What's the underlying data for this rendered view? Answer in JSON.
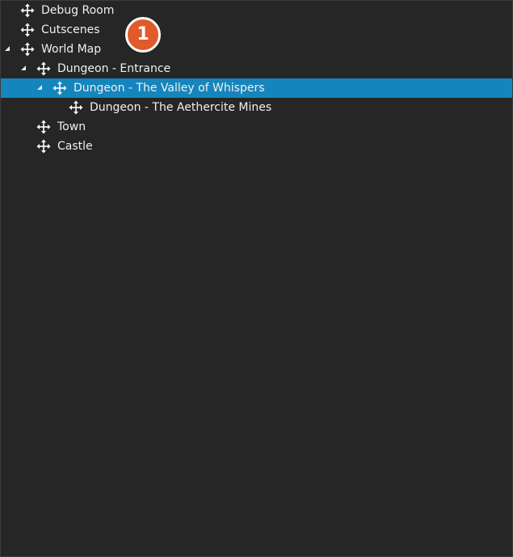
{
  "tree": {
    "items": [
      {
        "label": "Debug Room",
        "icon": "move-icon",
        "expanded": false,
        "has_children": false,
        "selected": false
      },
      {
        "label": "Cutscenes",
        "icon": "move-icon",
        "expanded": false,
        "has_children": false,
        "selected": false
      },
      {
        "label": "World Map",
        "icon": "move-icon",
        "expanded": true,
        "has_children": true,
        "selected": false
      },
      {
        "label": "Dungeon - Entrance",
        "icon": "move-icon",
        "expanded": true,
        "has_children": true,
        "selected": false
      },
      {
        "label": "Dungeon - The Valley of Whispers",
        "icon": "move-icon",
        "expanded": true,
        "has_children": true,
        "selected": true
      },
      {
        "label": "Dungeon - The Aethercite Mines",
        "icon": "move-icon",
        "expanded": false,
        "has_children": false,
        "selected": false
      },
      {
        "label": "Town",
        "icon": "move-icon",
        "expanded": false,
        "has_children": false,
        "selected": false
      },
      {
        "label": "Castle",
        "icon": "move-icon",
        "expanded": false,
        "has_children": false,
        "selected": false
      }
    ]
  },
  "callout": {
    "number": "1"
  },
  "colors": {
    "background": "#262626",
    "selection": "#1585bd",
    "text": "#f0f0f0",
    "badge": "#e05a2a"
  }
}
